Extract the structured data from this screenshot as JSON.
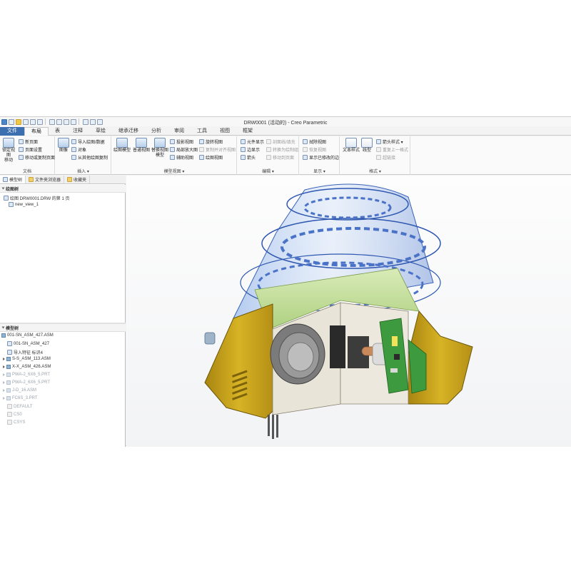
{
  "window": {
    "title": "DRW0001 (活动的) - Creo Parametric"
  },
  "tabs": [
    {
      "label": "文件"
    },
    {
      "label": "布局"
    },
    {
      "label": "表"
    },
    {
      "label": "注释"
    },
    {
      "label": "草绘"
    },
    {
      "label": "继承迁移"
    },
    {
      "label": "分析"
    },
    {
      "label": "审阅"
    },
    {
      "label": "工具"
    },
    {
      "label": "视图"
    },
    {
      "label": "框架"
    }
  ],
  "ribbon": {
    "doc": {
      "big_label_1": "锁定视图",
      "big_label_2": "移动",
      "new_page": "新页面",
      "page_setup": "页面设置",
      "move_copy_page": "移动或复制页面",
      "group": "文档"
    },
    "insert": {
      "image": "图像",
      "import_drawing": "导入绘图/数据",
      "object": "对象",
      "copy_from_other": "从其他绘图复制",
      "group": "插入 ▾"
    },
    "model_views": {
      "drawing_model": "绘图模型",
      "general_view": "普通视图",
      "replace_view_1": "替换视图",
      "replace_view_2": "模型",
      "projection_view": "投影视图",
      "detailed_view": "局部放大图",
      "auxiliary_view": "辅助视图",
      "rotated_view": "旋转视图",
      "copy_align_view": "复制并对齐视图",
      "drawing_view": "绘图视图",
      "group": "模型视图 ▾"
    },
    "edit": {
      "element_display": "元件显示",
      "edge_display": "边显示",
      "arrow": "箭头",
      "hatch": "剖面线/填充",
      "convert_to_sketch": "转换为绘制组",
      "move_to_page": "移动到页面",
      "group": "编辑 ▾"
    },
    "display": {
      "erase_view": "拭除视图",
      "resume_view": "恢复视图",
      "show_modified_edges": "显示已修改的边",
      "group": "显示 ▾"
    },
    "format": {
      "text_style": "文本样式",
      "line_style": "线型",
      "arrow_style": "箭头样式 ▾",
      "repeat_last_format": "重复上一格式",
      "hyperlink": "超链接",
      "group": "格式 ▾"
    }
  },
  "left_panel": {
    "nav_tabs": [
      {
        "label": "模型树"
      },
      {
        "label": "文件夹浏览器"
      },
      {
        "label": "收藏夹"
      }
    ],
    "drawing_tree": {
      "header": "绘图树",
      "items": [
        {
          "label": "绘图 DRW0001.DRW 的第 1 页"
        },
        {
          "label": "new_view_1"
        }
      ]
    },
    "model_tree": {
      "header": "模型树",
      "items": [
        {
          "label": "001-SN_ASM_427.ASM"
        },
        {
          "label": "001-SN_ASM_427"
        },
        {
          "label": "导入特征 标识4"
        },
        {
          "label": "S-S_ASM_113.ASM"
        },
        {
          "label": "X-X_ASM_426.ASM"
        },
        {
          "label": "PWA-2_6X6_5.PRT"
        },
        {
          "label": "PWA-2_6X6_5.PRT"
        },
        {
          "label": "J-D_16.ASM"
        },
        {
          "label": "FC6S_3.PRT"
        },
        {
          "label": "DEFAULT"
        },
        {
          "label": "CS0"
        },
        {
          "label": "CSYS"
        }
      ]
    }
  },
  "colors": {
    "file_tab": "#3c6fb0",
    "housing_yellow": "#c9a41a",
    "glass_blue": "#6f97d8",
    "pcb_green": "#3e9a3e"
  }
}
